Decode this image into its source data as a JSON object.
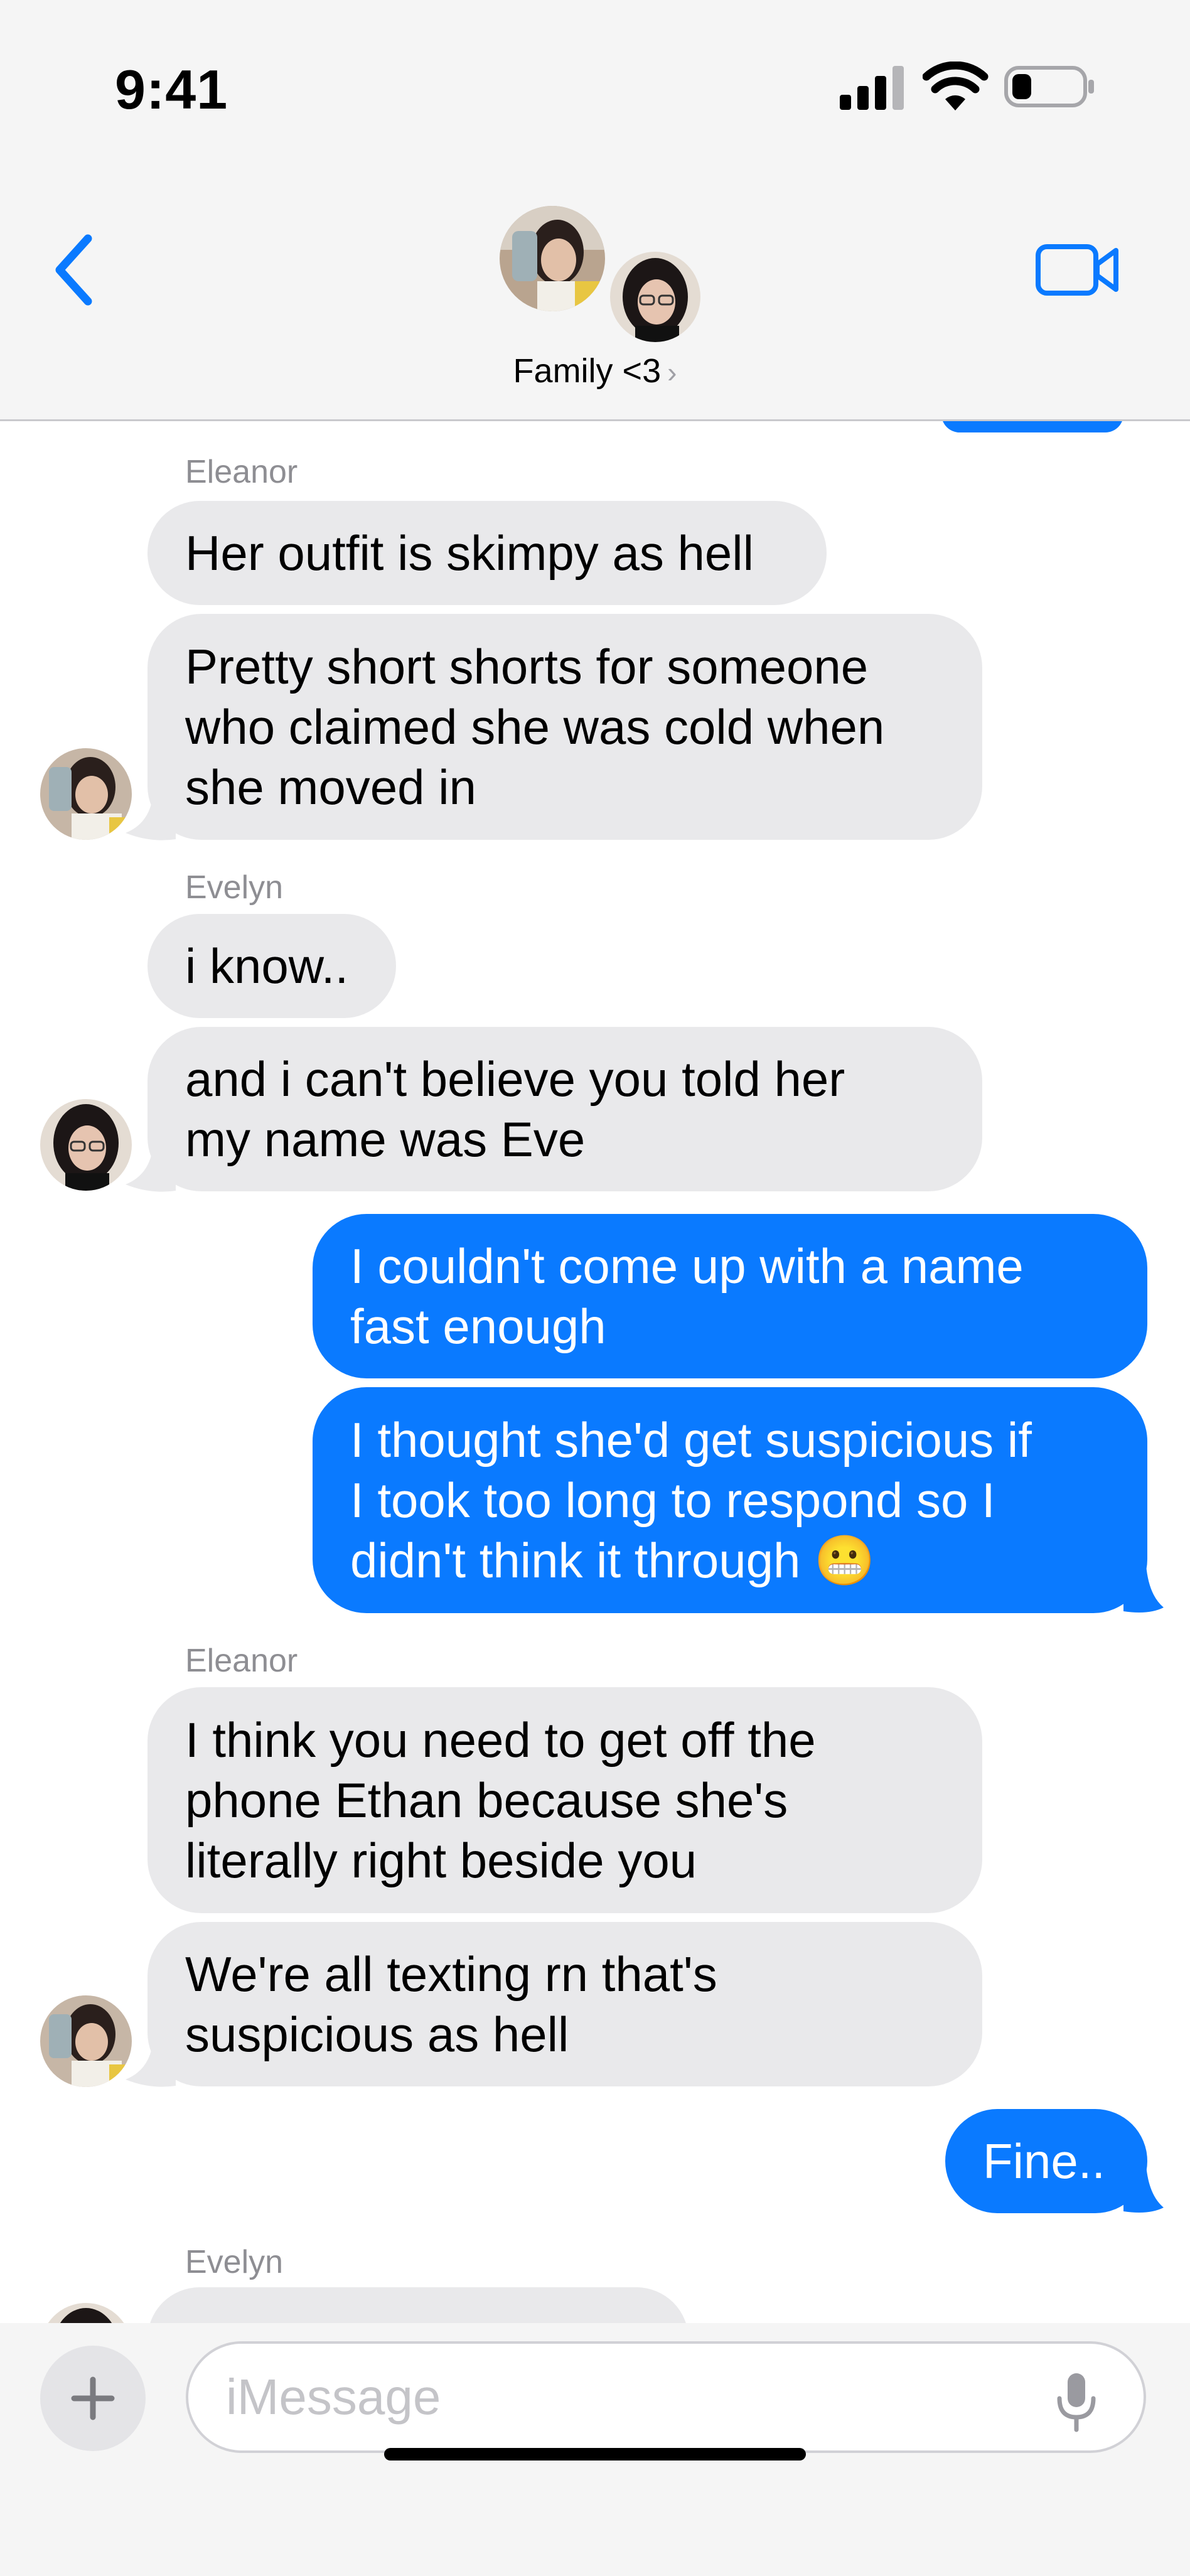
{
  "status_bar": {
    "time": "9:41"
  },
  "header": {
    "group_name": "Family <3",
    "chevron": "›"
  },
  "icons": {
    "back": "chevron-left-icon",
    "video": "video-camera-icon",
    "plus": "plus-icon",
    "mic": "microphone-icon",
    "signal": "cellular-signal-icon",
    "wifi": "wifi-icon",
    "battery": "battery-icon"
  },
  "colors": {
    "accent": "#0a7aff",
    "incoming_bubble": "#e9e9eb",
    "header_bg": "#f5f5f5",
    "sender_name": "#8e8e93"
  },
  "messages": [
    {
      "sender": "Eleanor",
      "direction": "in",
      "lines": [
        "Her outfit is skimpy as hell"
      ]
    },
    {
      "sender": "Eleanor",
      "direction": "in",
      "lines": [
        "Pretty short shorts for someone",
        "who claimed she was cold when",
        "she moved in"
      ]
    },
    {
      "sender": "Evelyn",
      "direction": "in",
      "lines": [
        "i know.."
      ]
    },
    {
      "sender": "Evelyn",
      "direction": "in",
      "lines": [
        "and i can't believe you told her",
        "my name was Eve"
      ]
    },
    {
      "sender": "me",
      "direction": "out",
      "lines": [
        "I couldn't come up with a name",
        "fast enough"
      ]
    },
    {
      "sender": "me",
      "direction": "out",
      "lines": [
        "I thought she'd get suspicious if",
        "I took too long to respond so I",
        "didn't think it through 😬"
      ]
    },
    {
      "sender": "Eleanor",
      "direction": "in",
      "lines": [
        "I think you need to get off the",
        "phone Ethan because she's",
        "literally right beside you"
      ]
    },
    {
      "sender": "Eleanor",
      "direction": "in",
      "lines": [
        "We're all texting rn that's",
        "suspicious as hell"
      ]
    },
    {
      "sender": "me",
      "direction": "out",
      "lines": [
        "Fine.."
      ]
    },
    {
      "sender": "Evelyn",
      "direction": "in",
      "lines": [
        ""
      ]
    }
  ],
  "sender_labels": [
    "Eleanor",
    "Evelyn",
    "Eleanor",
    "Evelyn"
  ],
  "composer": {
    "placeholder": "iMessage"
  }
}
